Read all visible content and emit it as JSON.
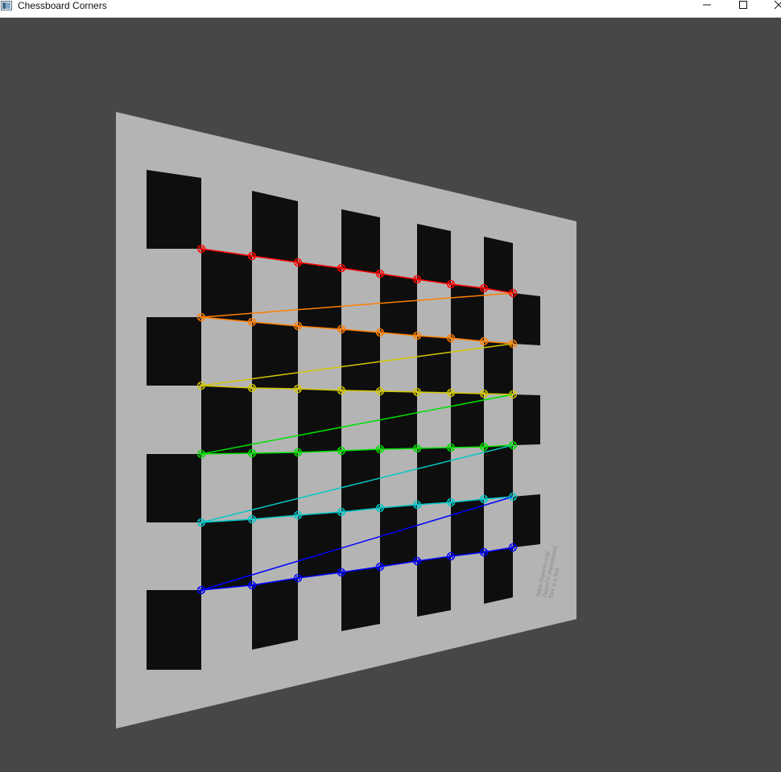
{
  "window": {
    "title": "Chessboard Corners",
    "icon": "app-window-icon",
    "controls": {
      "minimize_icon": "minimize-icon",
      "maximize_icon": "maximize-icon",
      "close_icon": "close-icon"
    }
  },
  "viewport": {
    "background": "#474747",
    "board_color": "#b4b4b4",
    "square_color": "#0e0e0e",
    "board_printed_text": [
      "This is a 9x6",
      "OpenCV chessboard",
      "https://opencv.org/"
    ]
  },
  "corner_overlay": {
    "pattern_size": "9x6",
    "row_colors": [
      "#ff0000",
      "#ff7f00",
      "#d2c800",
      "#00e000",
      "#00c8c8",
      "#0000ff"
    ]
  }
}
